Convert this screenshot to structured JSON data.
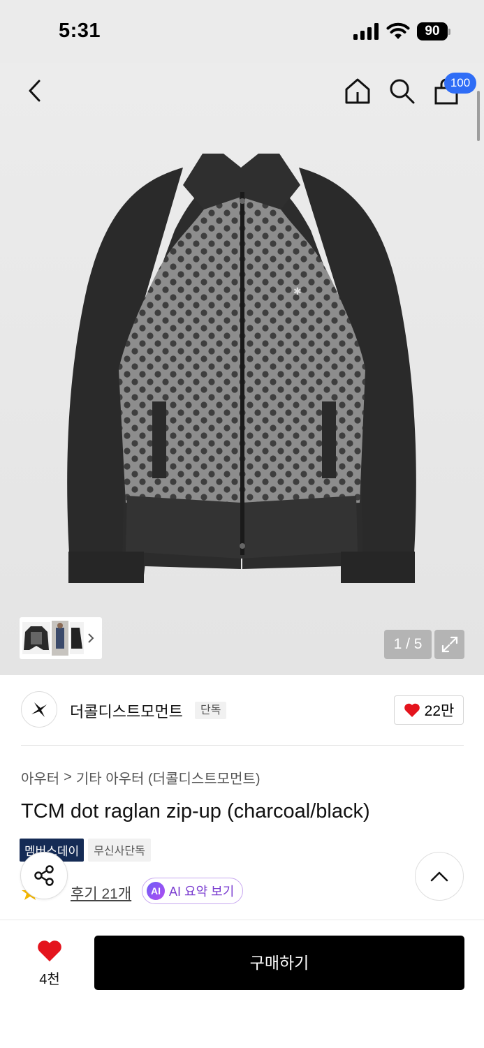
{
  "status_bar": {
    "time": "5:31",
    "battery": "90"
  },
  "nav": {
    "cart_count": "100"
  },
  "gallery": {
    "counter": "1 / 5"
  },
  "brand": {
    "name": "더콜디스트모먼트",
    "badge": "단독",
    "likes": "22만"
  },
  "breadcrumb": {
    "level1": "아우터",
    "separator": ">",
    "level2": "기타 아우터 (더콜디스트모먼트)"
  },
  "product": {
    "title": "TCM dot raglan zip-up (charcoal/black)",
    "tags": [
      "멤버스데이",
      "무신사단독"
    ],
    "review_label": "후기 21개",
    "ai_icon": "AI",
    "ai_summary_label": "AI 요약 보기"
  },
  "bottom": {
    "favorite_count": "4천",
    "buy_label": "구매하기"
  },
  "colors": {
    "accent_blue": "#2f6df6",
    "heart_red": "#e4141d",
    "tag_navy": "#152b55",
    "ai_purple": "#7a3cd0"
  }
}
